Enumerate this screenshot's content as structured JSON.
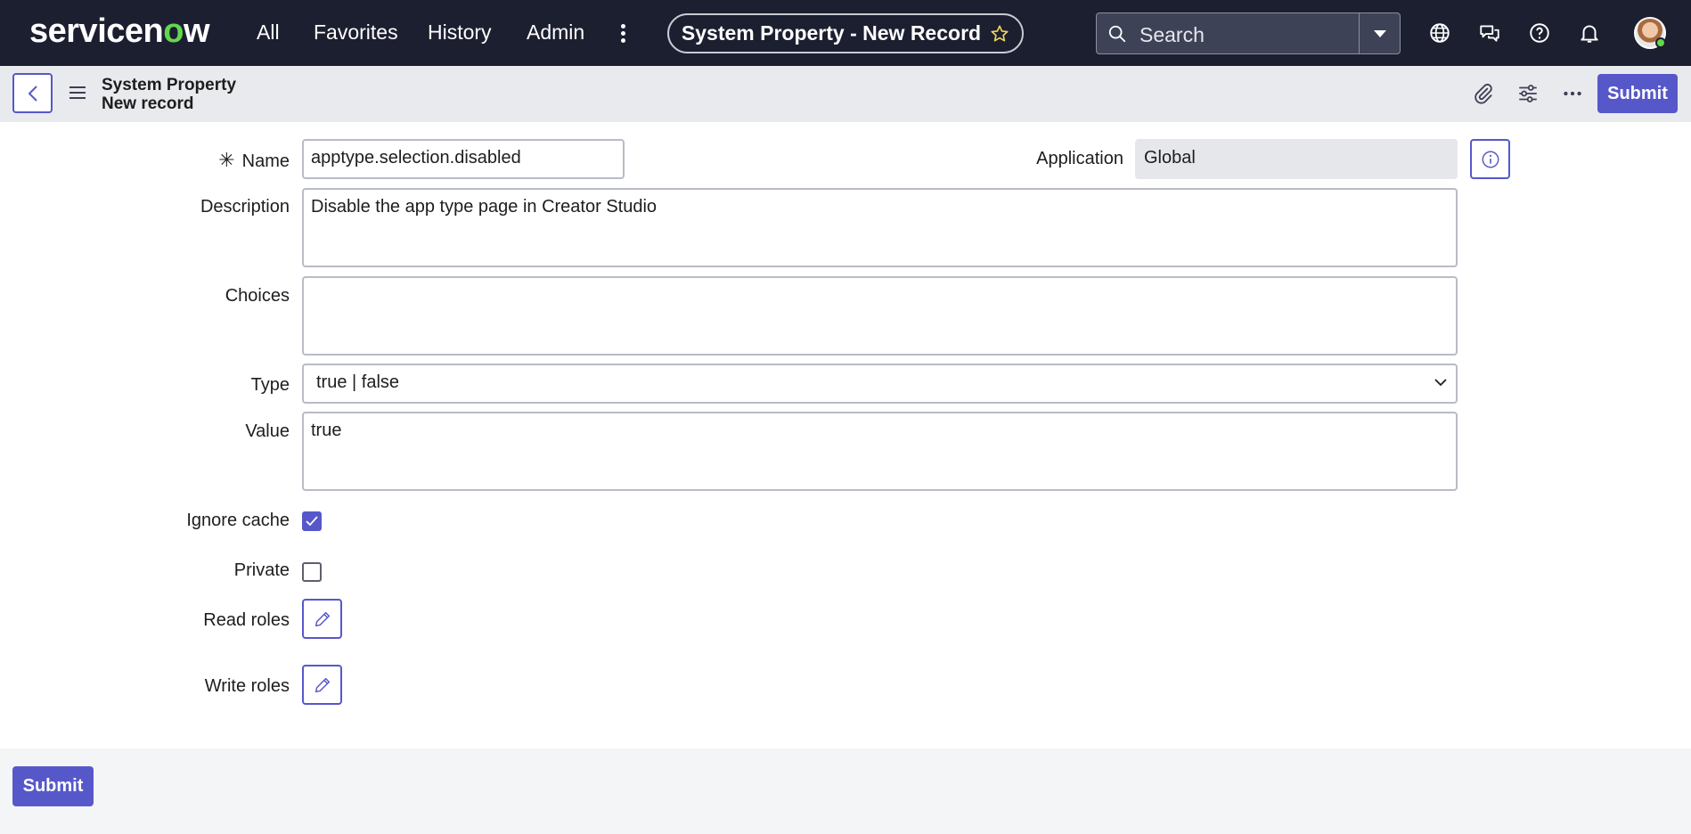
{
  "topnav": {
    "logo": "servicenow",
    "links": [
      "All",
      "Favorites",
      "History",
      "Admin"
    ],
    "record_title": "System Property - New Record",
    "search_placeholder": "Search"
  },
  "header": {
    "title_line1": "System Property",
    "title_line2": "New record",
    "submit_label": "Submit"
  },
  "form": {
    "name": {
      "label": "Name",
      "value": "apptype.selection.disabled",
      "required": true
    },
    "application": {
      "label": "Application",
      "value": "Global"
    },
    "description": {
      "label": "Description",
      "value": "Disable the app type page in Creator Studio"
    },
    "choices": {
      "label": "Choices",
      "value": ""
    },
    "type": {
      "label": "Type",
      "value": "true | false"
    },
    "value": {
      "label": "Value",
      "value": "true"
    },
    "ignore_cache": {
      "label": "Ignore cache",
      "checked": true
    },
    "private": {
      "label": "Private",
      "checked": false
    },
    "read_roles": {
      "label": "Read roles"
    },
    "write_roles": {
      "label": "Write roles"
    }
  },
  "footer": {
    "submit_label": "Submit"
  },
  "colors": {
    "primary": "#5658c9",
    "nav_bg": "#1c1f30",
    "accent_green": "#62d84e"
  }
}
